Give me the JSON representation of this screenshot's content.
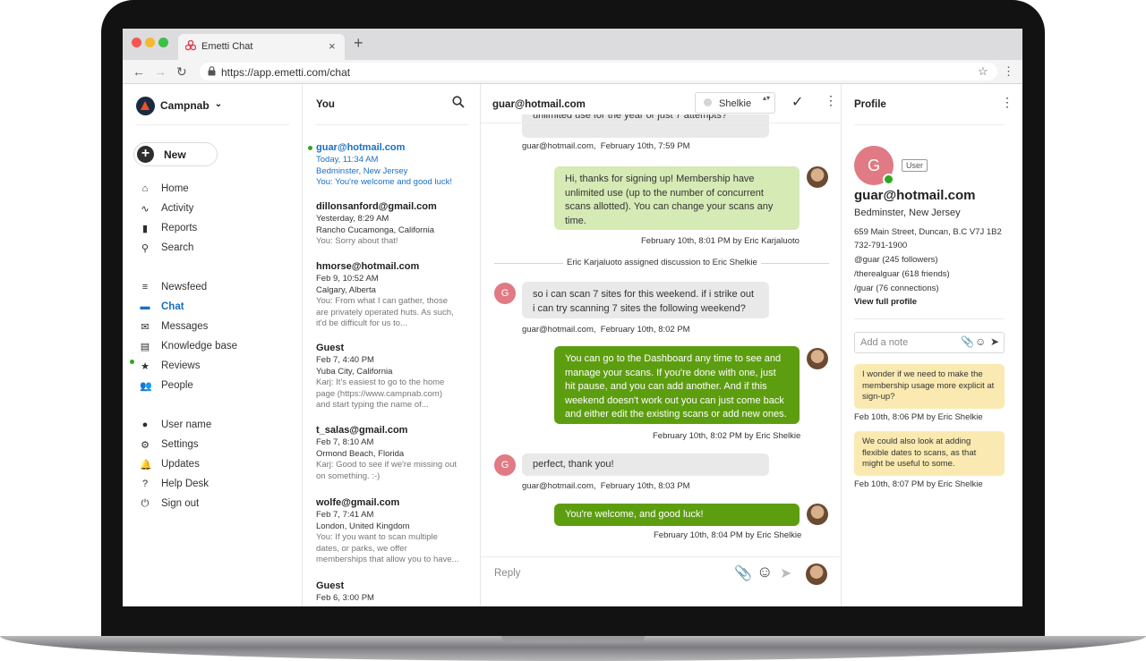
{
  "browser": {
    "tab_title": "Emetti Chat",
    "tab_close": "×",
    "new_tab": "+",
    "url": "https://app.emetti.com/chat",
    "back": "←",
    "forward": "→",
    "reload": "↻",
    "bookmark": "☆",
    "menu": "⋮"
  },
  "sidebar": {
    "org_name": "Campnab",
    "org_chevron": "⌄",
    "new_label": "New",
    "new_plus": "+",
    "items": [
      {
        "label": "Home",
        "icon": "home-icon",
        "glyph": "⌂"
      },
      {
        "label": "Activity",
        "icon": "activity-icon",
        "glyph": "∿"
      },
      {
        "label": "Reports",
        "icon": "reports-icon",
        "glyph": "▮"
      },
      {
        "label": "Search",
        "icon": "search-icon",
        "glyph": "⚲"
      },
      {
        "label": "Newsfeed",
        "icon": "newsfeed-icon",
        "glyph": "≡"
      },
      {
        "label": "Chat",
        "icon": "chat-icon",
        "glyph": "▬"
      },
      {
        "label": "Messages",
        "icon": "messages-icon",
        "glyph": "✉"
      },
      {
        "label": "Knowledge base",
        "icon": "knowledge-base-icon",
        "glyph": "▤"
      },
      {
        "label": "Reviews",
        "icon": "star-icon",
        "glyph": "★"
      },
      {
        "label": "People",
        "icon": "people-icon",
        "glyph": "👥"
      },
      {
        "label": "User name",
        "icon": "user-icon",
        "glyph": "●"
      },
      {
        "label": "Settings",
        "icon": "gear-icon",
        "glyph": "⚙"
      },
      {
        "label": "Updates",
        "icon": "bell-icon",
        "glyph": "🔔"
      },
      {
        "label": "Help Desk",
        "icon": "help-icon",
        "glyph": "?"
      },
      {
        "label": "Sign out",
        "icon": "power-icon",
        "glyph": "⏻"
      }
    ]
  },
  "list": {
    "header": "You",
    "conversations": [
      {
        "name": "guar@hotmail.com",
        "time": "Today, 11:34 AM",
        "location": "Bedminster, New Jersey",
        "preview": [
          "You: You're welcome and good luck!"
        ]
      },
      {
        "name": "dillonsanford@gmail.com",
        "time": "Yesterday, 8:29 AM",
        "location": "Rancho Cucamonga, California",
        "preview": [
          "You: Sorry about that!"
        ]
      },
      {
        "name": "hmorse@hotmail.com",
        "time": "Feb 9, 10:52 AM",
        "location": "Calgary, Alberta",
        "preview": [
          "You: From what I can gather, those",
          "are privately operated huts. As such,",
          "it'd be difficult for us to..."
        ]
      },
      {
        "name": "Guest",
        "time": "Feb 7, 4:40 PM",
        "location": "Yuba City, California",
        "preview": [
          "Karj: It's easiest to go to the home",
          "page (https://www.campnab.com)",
          "and start typing the name of..."
        ]
      },
      {
        "name": "t_salas@gmail.com",
        "time": "Feb 7, 8:10 AM",
        "location": "Ormond Beach, Florida",
        "preview": [
          "Karj: Good to see if we're missing out",
          "on something.  :-)"
        ]
      },
      {
        "name": "wolfe@gmail.com",
        "time": "Feb 7, 7:41 AM",
        "location": "London, United Kingdom",
        "preview": [
          "You: If you want to scan multiple",
          "dates, or parks, we offer",
          "memberships that allow you to have..."
        ]
      },
      {
        "name": "Guest",
        "time": "Feb 6, 3:00 PM",
        "location": "",
        "preview": []
      }
    ]
  },
  "chat": {
    "header": "guar@hotmail.com",
    "assignee": "Shelkie",
    "assign_arrows": "▴▾",
    "resolve": "✓",
    "menu": "⋮",
    "messages": [
      {
        "text": "unlimited use for the year or just 7 attempts?",
        "meta_name": "guar@hotmail.com,",
        "meta_time": "February 10th, 7:59 PM"
      },
      {
        "text": "Hi, thanks for signing up! Membership have unlimited use (up to the number of concurrent scans allotted). You can change your scans any time.",
        "meta_time": "February 10th, 8:01 PM by",
        "meta_name": "Eric Karjaluoto"
      },
      {
        "text": "so i can scan 7 sites for this weekend. if i strike out i can try scanning 7 sites the following weekend?",
        "meta_name": "guar@hotmail.com,",
        "meta_time": "February 10th, 8:02 PM",
        "avatar": "G"
      },
      {
        "text": "You can go to the Dashboard any time to see and manage your scans. If you're done with one, just hit pause, and you can add another. And if this weekend doesn't work out you can just come back and either edit the existing scans or add new ones.",
        "meta_time": "February 10th, 8:02 PM by",
        "meta_name": "Eric Shelkie"
      },
      {
        "text": "perfect, thank you!",
        "meta_name": "guar@hotmail.com,",
        "meta_time": "February 10th, 8:03 PM",
        "avatar": "G"
      },
      {
        "text": "You're welcome, and good luck!",
        "meta_time": "February 10th, 8:04 PM by",
        "meta_name": "Eric Shelkie"
      }
    ],
    "system": {
      "actor": "Eric Karjaluoto",
      "action": "assigned discussion to",
      "target": "Eric Shelkie"
    },
    "reply_placeholder": "Reply",
    "attach": "📎",
    "emoji": "☺",
    "send": "➤"
  },
  "profile": {
    "header": "Profile",
    "menu": "⋮",
    "avatar": "G",
    "badge": "User",
    "name": "guar@hotmail.com",
    "location": "Bedminster, New Jersey",
    "address": "659 Main Street, Duncan, B.C  V7J 1B2",
    "phone": "732-791-1900",
    "social1": "@guar (245 followers)",
    "social2": "/therealguar (618 friends)",
    "social3": "/guar (76 connections)",
    "view_full": "View full profile",
    "note_placeholder": "Add a note",
    "notes": [
      {
        "text": "I wonder if we need to make the membership usage more explicit at sign-up?",
        "meta": "Feb 10th, 8:06 PM by Eric Shelkie"
      },
      {
        "text": "We could also look at adding flexible dates to scans, as that might be useful to some.",
        "meta": "Feb 10th, 8:07 PM by Eric Shelkie"
      }
    ]
  },
  "colors": {
    "accent": "#1a6fc4",
    "online": "#2fa61f",
    "bubble_green": "#5d9e10",
    "bubble_light": "#d6eab5",
    "note_yellow": "#faeab1",
    "avatar_pink": "#e07a84"
  }
}
